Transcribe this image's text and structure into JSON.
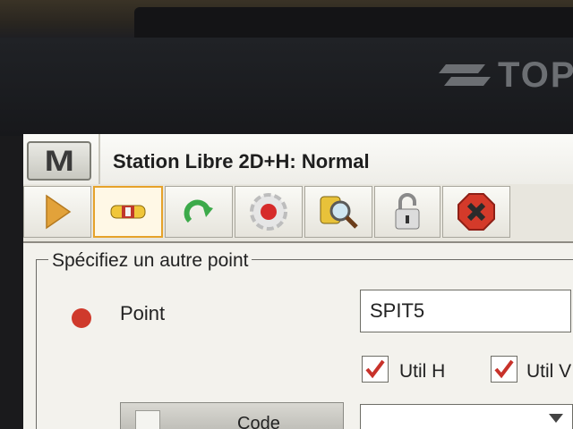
{
  "device": {
    "brand_text": "TOP"
  },
  "app": {
    "menu_button_label": "M",
    "title": "Station Libre 2D+H: Normal"
  },
  "toolbar": {
    "buttons": [
      {
        "icon": "play-arrow-icon"
      },
      {
        "icon": "prism-instrument-icon",
        "active": true
      },
      {
        "icon": "redo-arrow-icon"
      },
      {
        "icon": "target-icon"
      },
      {
        "icon": "search-magnifier-icon"
      },
      {
        "icon": "padlock-icon"
      },
      {
        "icon": "stop-close-icon"
      }
    ]
  },
  "form": {
    "group_legend": "Spécifiez un autre point",
    "point_label": "Point",
    "point_value": "SPIT5",
    "util_h_label": "Util H",
    "util_h_checked": true,
    "util_v_label": "Util V",
    "util_v_checked": true,
    "code_button_label": "Code",
    "code_value": ""
  },
  "colors": {
    "point_dot": "#cf3a2c",
    "active_tool_border": "#e6a22a",
    "stop_icon": "#d43a2a"
  }
}
